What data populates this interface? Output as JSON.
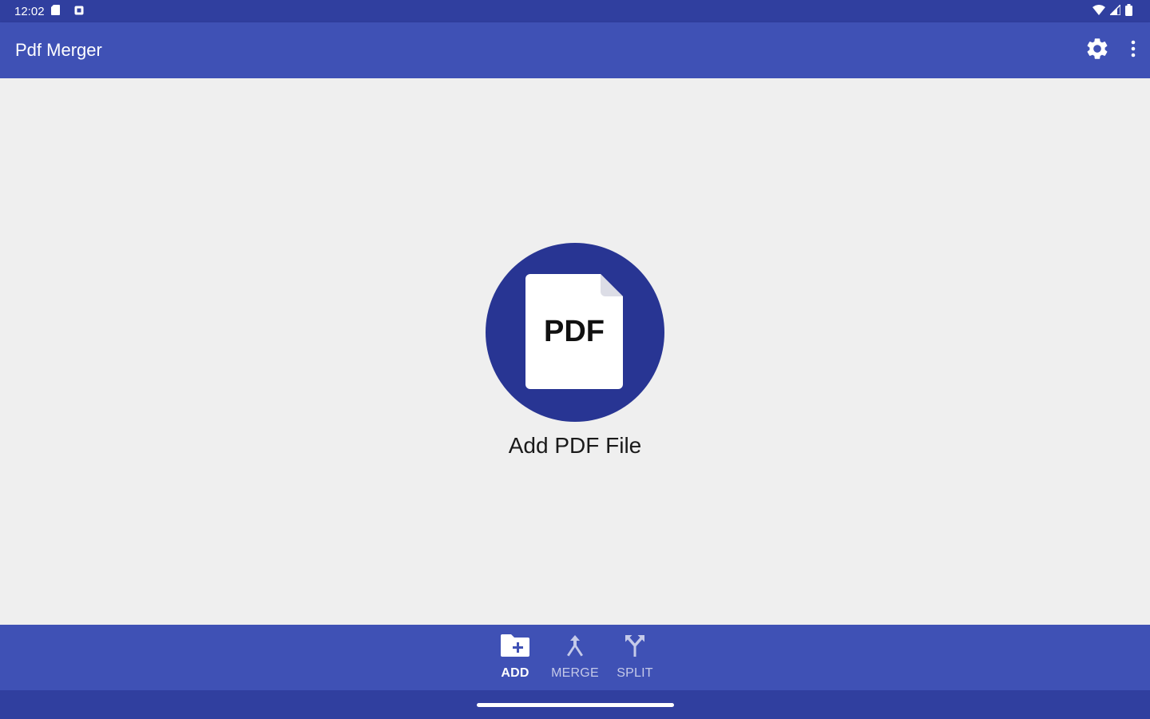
{
  "status_bar": {
    "time": "12:02",
    "icons": [
      "sd-card-icon",
      "notification-square-icon",
      "wifi-icon",
      "cell-signal-icon",
      "battery-icon"
    ]
  },
  "app_bar": {
    "title": "Pdf Merger",
    "icons": [
      "gear-icon",
      "more-vert-icon"
    ]
  },
  "main": {
    "pdf_icon_text": "PDF",
    "add_label": "Add PDF File",
    "icon": "pdf-file-icon"
  },
  "bottom_nav": {
    "items": [
      {
        "label": "ADD",
        "icon": "folder-add-icon",
        "active": true
      },
      {
        "label": "MERGE",
        "icon": "merge-icon",
        "active": false
      },
      {
        "label": "SPLIT",
        "icon": "split-icon",
        "active": false
      }
    ]
  },
  "colors": {
    "primary": "#3f51b5",
    "primary_dark": "#303f9f",
    "circle": "#283593",
    "background": "#efefef",
    "inactive_text": "#c5cae9"
  }
}
